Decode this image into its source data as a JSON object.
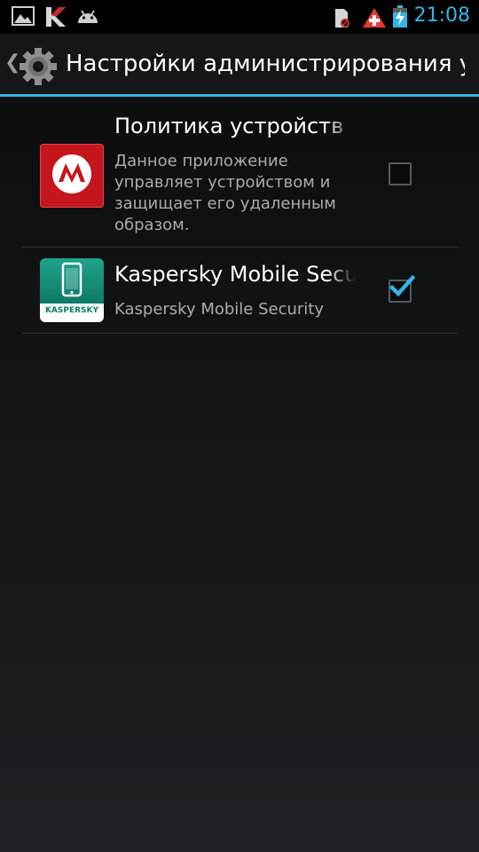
{
  "status_bar": {
    "time": "21:08",
    "icons": [
      "gallery-icon",
      "kaspersky-notification-icon",
      "android-debug-icon",
      "sd-card-icon",
      "warning-plus-icon",
      "battery-charging-icon"
    ],
    "accent": "#33b5e5"
  },
  "action_bar": {
    "title": "Настройки администрирования у...",
    "icon": "settings-gear-icon",
    "accent": "#33b5e5"
  },
  "device_admins": [
    {
      "title": "Политика устройств",
      "summary": "Данное приложение управляет устройством и защищает его удаленным образом.",
      "icon": "motorola-icon",
      "checked": false
    },
    {
      "title": "Kaspersky Mobile Security",
      "summary": "Kaspersky Mobile Security",
      "icon": "kaspersky-mobile-security-icon",
      "icon_badge_text": "KASPERSKY",
      "checked": true
    }
  ]
}
